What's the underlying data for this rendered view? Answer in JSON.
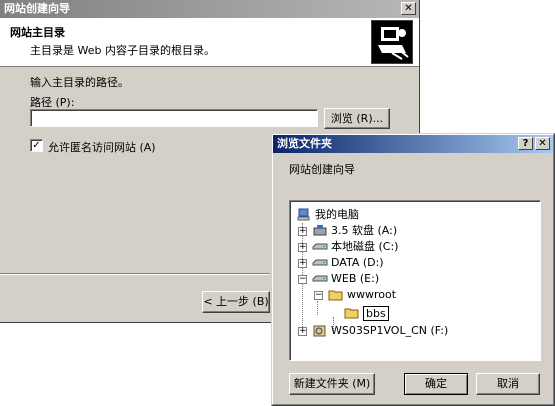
{
  "wizard": {
    "title": "网站创建向导",
    "close_glyph": "✕",
    "header_title": "网站主目录",
    "header_subtitle": "主目录是 Web 内容子目录的根目录。",
    "instruction": "输入主目录的路径。",
    "path_label": "路径 (P):",
    "path_value": "",
    "browse_button": "浏览 (R)...",
    "anon_checkbox_label": "允许匿名访问网站 (A)",
    "anon_checked": "✓",
    "back_button": "< 上一步 (B)"
  },
  "browse_dialog": {
    "title": "浏览文件夹",
    "help_glyph": "?",
    "close_glyph": "✕",
    "description": "网站创建向导",
    "tree": {
      "root": "我的电脑",
      "items": [
        {
          "label": "3.5 软盘 (A:)",
          "expander": "+"
        },
        {
          "label": "本地磁盘 (C:)",
          "expander": "+"
        },
        {
          "label": "DATA (D:)",
          "expander": "+"
        },
        {
          "label": "WEB (E:)",
          "expander": "−"
        },
        {
          "label": "wwwroot",
          "expander": "−"
        },
        {
          "label": "bbs",
          "expander": ""
        },
        {
          "label": "WS03SP1VOL_CN (F:)",
          "expander": "+"
        }
      ]
    },
    "new_folder_button": "新建文件夹 (M)",
    "ok_button": "确定",
    "cancel_button": "取消"
  }
}
